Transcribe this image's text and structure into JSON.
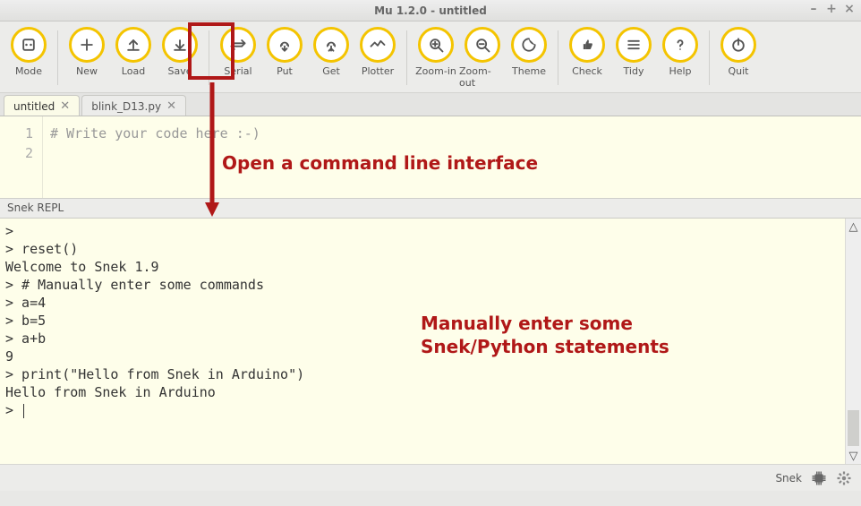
{
  "window": {
    "title": "Mu 1.2.0 - untitled",
    "buttons": {
      "min": "–",
      "max": "+",
      "close": "×"
    }
  },
  "toolbar": {
    "groups": [
      [
        "Mode"
      ],
      [
        "New",
        "Load",
        "Save"
      ],
      [
        "Serial",
        "Put",
        "Get",
        "Plotter"
      ],
      [
        "Zoom-in",
        "Zoom-out",
        "Theme"
      ],
      [
        "Check",
        "Tidy",
        "Help"
      ],
      [
        "Quit"
      ]
    ],
    "labels": {
      "Mode": "Mode",
      "New": "New",
      "Load": "Load",
      "Save": "Save",
      "Serial": "Serial",
      "Put": "Put",
      "Get": "Get",
      "Plotter": "Plotter",
      "Zoom-in": "Zoom-in",
      "Zoom-out": "Zoom-out",
      "Theme": "Theme",
      "Check": "Check",
      "Tidy": "Tidy",
      "Help": "Help",
      "Quit": "Quit"
    }
  },
  "tabs": [
    {
      "label": "untitled",
      "active": true
    },
    {
      "label": "blink_D13.py",
      "active": false
    }
  ],
  "editor": {
    "lines": [
      "# Write your code here :-)",
      ""
    ]
  },
  "repl": {
    "title": "Snek REPL",
    "lines": [
      ">",
      "> reset()",
      "Welcome to Snek 1.9",
      "> # Manually enter some commands",
      "> a=4",
      "> b=5",
      "> a+b",
      "9",
      "> print(\"Hello from Snek in Arduino\")",
      "Hello from Snek in Arduino",
      "> "
    ]
  },
  "status": {
    "mode": "Snek"
  },
  "annotations": {
    "serial": "Open a command line interface",
    "repl": "Manually enter some\nSnek/Python statements"
  }
}
